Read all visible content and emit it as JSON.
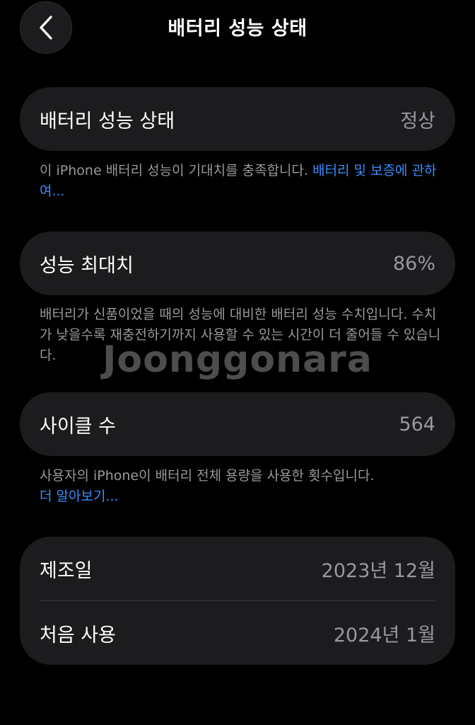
{
  "nav": {
    "title": "배터리 성능 상태",
    "back_icon": "chevron-left-icon"
  },
  "battery_health": {
    "label": "배터리 성능 상태",
    "value": "정상",
    "note_text": "이 iPhone 배터리 성능이 기대치를 충족합니다. ",
    "note_link": "배터리 및 보증에 관하여..."
  },
  "max_capacity": {
    "label": "성능 최대치",
    "value": "86%",
    "note_text": "배터리가 신품이었을 때의 성능에 대비한 배터리 성능 수치입니다. 수치가 낮을수록 재충전하기까지 사용할 수 있는 시간이 더 줄어들 수 있습니다."
  },
  "cycle_count": {
    "label": "사이클 수",
    "value": "564",
    "note_text": "사용자의 iPhone이 배터리 전체 용량을 사용한 횟수입니다.",
    "note_link": "더 알아보기..."
  },
  "dates": {
    "manufacture_label": "제조일",
    "manufacture_value": "2023년 12월",
    "first_use_label": "처음 사용",
    "first_use_value": "2024년 1월"
  },
  "watermark": "Joonggonara",
  "colors": {
    "background": "#000000",
    "card": "#1c1c1e",
    "secondary_text": "#98989e",
    "link": "#3a8cff"
  }
}
